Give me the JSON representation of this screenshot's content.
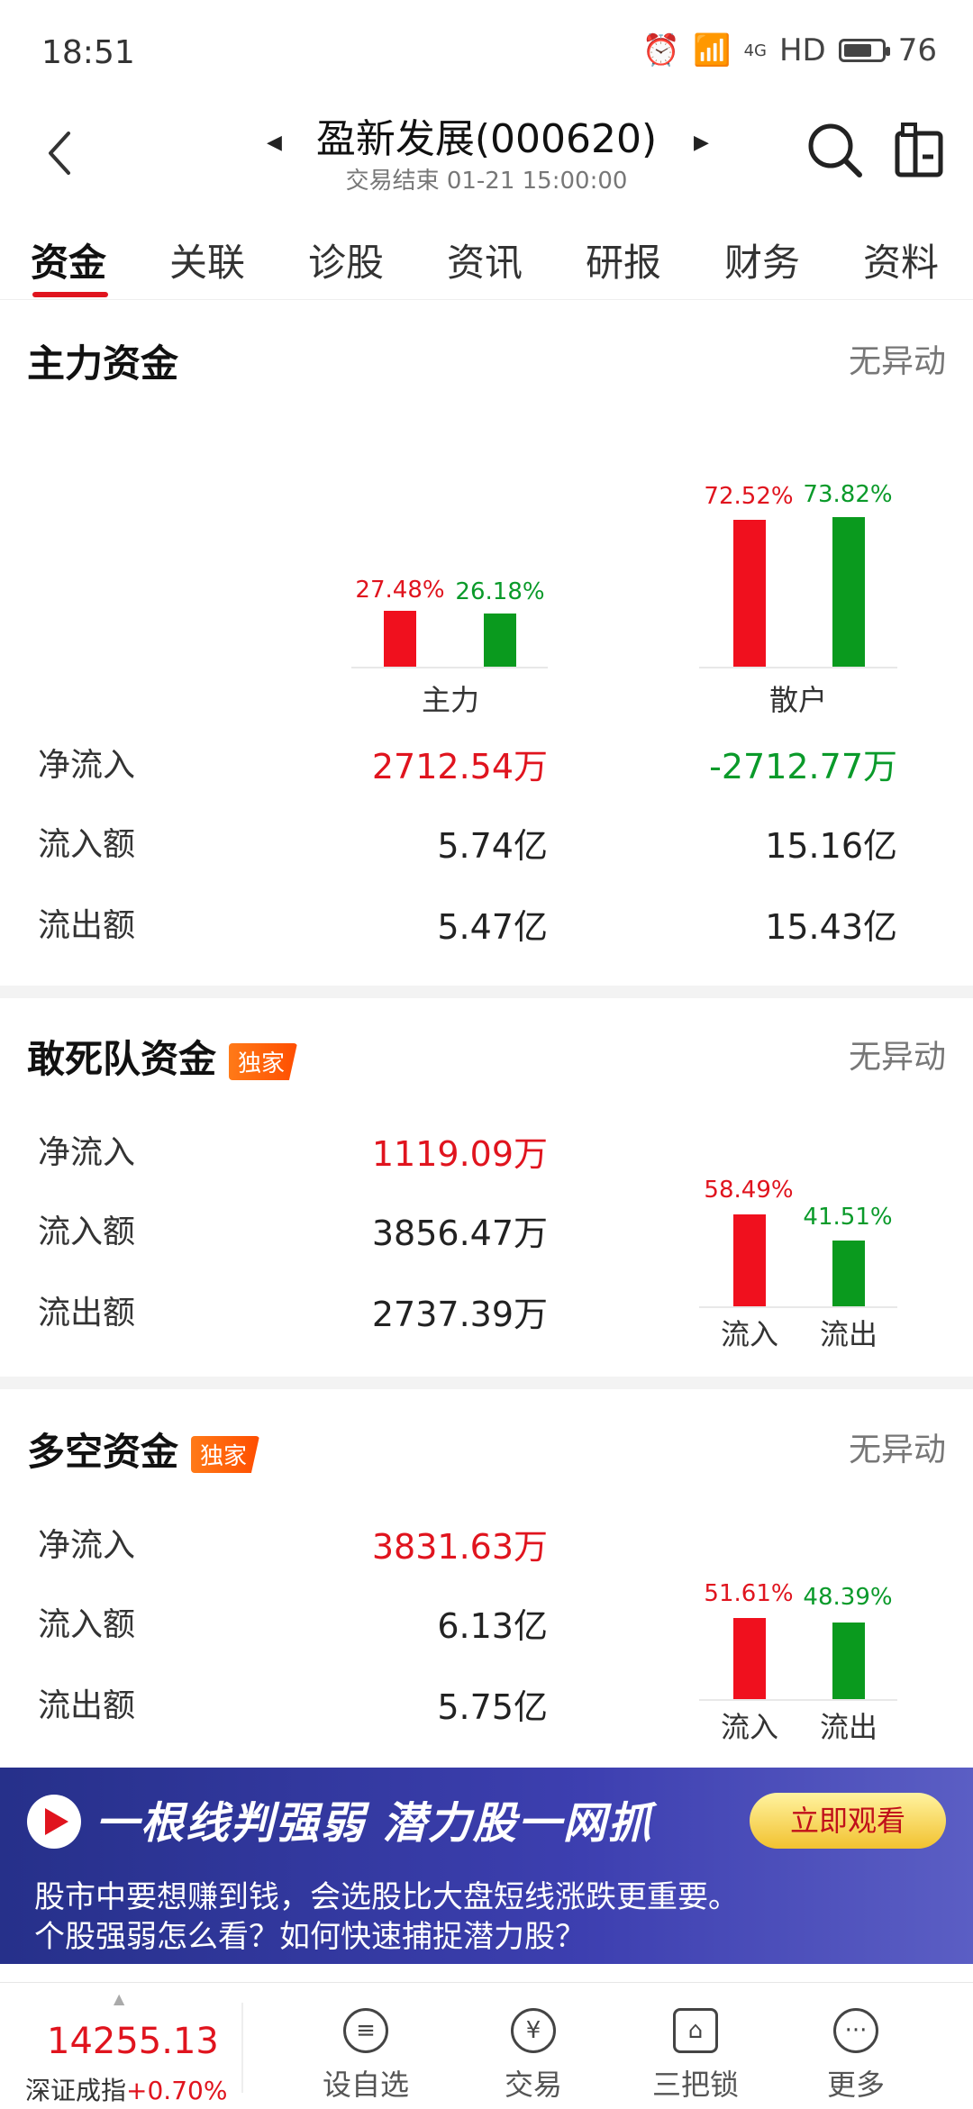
{
  "status_bar": {
    "time": "18:51",
    "network": "4G",
    "hd": "HD",
    "battery": "76",
    "battery_fraction": 0.76
  },
  "header": {
    "title": "盈新发展(000620)",
    "subtitle": "交易结束 01-21 15:00:00"
  },
  "tabs": [
    "资金",
    "关联",
    "诊股",
    "资讯",
    "研报",
    "财务",
    "资料"
  ],
  "main_fund": {
    "title": "主力资金",
    "note": "无异动",
    "groups": [
      {
        "label": "主力",
        "in_pct": "27.48%",
        "out_pct": "26.18%",
        "in_value": 27.48,
        "out_value": 26.18
      },
      {
        "label": "散户",
        "in_pct": "72.52%",
        "out_pct": "73.82%",
        "in_value": 72.52,
        "out_value": 73.82
      }
    ],
    "rows": [
      {
        "label": "净流入",
        "main": "2712.54万",
        "retail": "-2712.77万"
      },
      {
        "label": "流入额",
        "main": "5.74亿",
        "retail": "15.16亿"
      },
      {
        "label": "流出额",
        "main": "5.47亿",
        "retail": "15.43亿"
      }
    ]
  },
  "daredevil_fund": {
    "title": "敢死队资金",
    "badge": "独家",
    "note": "无异动",
    "rows": [
      {
        "label": "净流入",
        "value": "1119.09万"
      },
      {
        "label": "流入额",
        "value": "3856.47万"
      },
      {
        "label": "流出额",
        "value": "2737.39万"
      }
    ],
    "chart": {
      "in_label": "流入",
      "out_label": "流出",
      "in_pct": "58.49%",
      "out_pct": "41.51%",
      "in_value": 58.49,
      "out_value": 41.51
    }
  },
  "longshort_fund": {
    "title": "多空资金",
    "badge": "独家",
    "note": "无异动",
    "rows": [
      {
        "label": "净流入",
        "value": "3831.63万"
      },
      {
        "label": "流入额",
        "value": "6.13亿"
      },
      {
        "label": "流出额",
        "value": "5.75亿"
      }
    ],
    "chart": {
      "in_label": "流入",
      "out_label": "流出",
      "in_pct": "51.61%",
      "out_pct": "48.39%",
      "in_value": 51.61,
      "out_value": 48.39
    }
  },
  "banner": {
    "headline": "一根线判强弱  潜力股一网抓",
    "button": "立即观看",
    "line1": "股市中要想赚到钱，会选股比大盘短线涨跌更重要。",
    "line2": "个股强弱怎么看？如何快速捕捉潜力股？"
  },
  "bottom_bar": {
    "index_value": "14255.13",
    "index_name": "深证成指",
    "index_change": "+0.70%",
    "nav": [
      {
        "label": "设自选",
        "icon": "menu-circle-icon"
      },
      {
        "label": "交易",
        "icon": "yuan-icon"
      },
      {
        "label": "三把锁",
        "icon": "lock-stack-icon"
      },
      {
        "label": "更多",
        "icon": "more-icon"
      }
    ]
  },
  "colors": {
    "red": "#e0141e",
    "green": "#0a9a2a",
    "accent": "#e0141e"
  }
}
